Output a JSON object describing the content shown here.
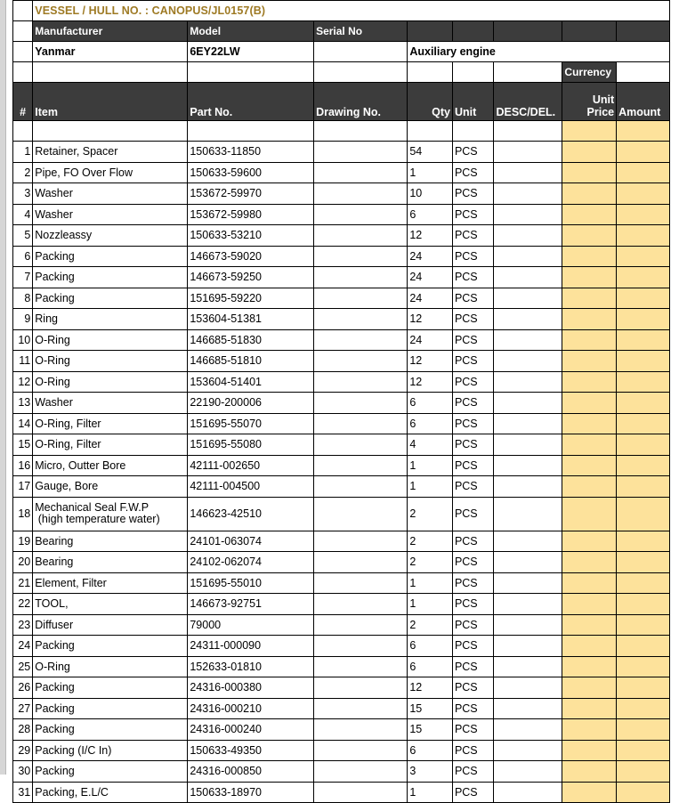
{
  "document": {
    "vessel_label": "VESSEL / HULL NO. : CANOPUS/JL0157(B)"
  },
  "vessel_info": {
    "headers": [
      "Manufacturer",
      "Model",
      "Serial No"
    ],
    "manufacturer": "Yanmar",
    "model": "6EY22LW",
    "serial_no": "",
    "description": "Auxiliary engine"
  },
  "currency": {
    "label": "Currency",
    "value": ""
  },
  "table": {
    "columns": {
      "num": "#",
      "item": "Item",
      "part_no": "Part No.",
      "drawing_no": "Drawing No.",
      "qty": "Qty",
      "unit": "Unit",
      "desc_del": "DESC/DEL.",
      "unit_price_line1": "Unit",
      "unit_price_line2": "Price",
      "amount": "Amount"
    },
    "rows": [
      {
        "num": "1",
        "item": "Retainer, Spacer",
        "part_no": "150633-11850",
        "drawing_no": "",
        "qty": "54",
        "unit": "PCS",
        "desc_del": "",
        "unit_price": "",
        "amount": ""
      },
      {
        "num": "2",
        "item": "Pipe, FO Over Flow",
        "part_no": "150633-59600",
        "drawing_no": "",
        "qty": "1",
        "unit": "PCS",
        "desc_del": "",
        "unit_price": "",
        "amount": ""
      },
      {
        "num": "3",
        "item": "Washer",
        "part_no": "153672-59970",
        "drawing_no": "",
        "qty": "10",
        "unit": "PCS",
        "desc_del": "",
        "unit_price": "",
        "amount": ""
      },
      {
        "num": "4",
        "item": "Washer",
        "part_no": "153672-59980",
        "drawing_no": "",
        "qty": "6",
        "unit": "PCS",
        "desc_del": "",
        "unit_price": "",
        "amount": ""
      },
      {
        "num": "5",
        "item": "Nozzleassy",
        "part_no": "150633-53210",
        "drawing_no": "",
        "qty": "12",
        "unit": "PCS",
        "desc_del": "",
        "unit_price": "",
        "amount": ""
      },
      {
        "num": "6",
        "item": "Packing",
        "part_no": "146673-59020",
        "drawing_no": "",
        "qty": "24",
        "unit": "PCS",
        "desc_del": "",
        "unit_price": "",
        "amount": ""
      },
      {
        "num": "7",
        "item": "Packing",
        "part_no": "146673-59250",
        "drawing_no": "",
        "qty": "24",
        "unit": "PCS",
        "desc_del": "",
        "unit_price": "",
        "amount": ""
      },
      {
        "num": "8",
        "item": "Packing",
        "part_no": "151695-59220",
        "drawing_no": "",
        "qty": "24",
        "unit": "PCS",
        "desc_del": "",
        "unit_price": "",
        "amount": ""
      },
      {
        "num": "9",
        "item": "Ring",
        "part_no": "153604-51381",
        "drawing_no": "",
        "qty": "12",
        "unit": "PCS",
        "desc_del": "",
        "unit_price": "",
        "amount": ""
      },
      {
        "num": "10",
        "item": "O-Ring",
        "part_no": "146685-51830",
        "drawing_no": "",
        "qty": "24",
        "unit": "PCS",
        "desc_del": "",
        "unit_price": "",
        "amount": ""
      },
      {
        "num": "11",
        "item": "O-Ring",
        "part_no": "146685-51810",
        "drawing_no": "",
        "qty": "12",
        "unit": "PCS",
        "desc_del": "",
        "unit_price": "",
        "amount": ""
      },
      {
        "num": "12",
        "item": "O-Ring",
        "part_no": "153604-51401",
        "drawing_no": "",
        "qty": "12",
        "unit": "PCS",
        "desc_del": "",
        "unit_price": "",
        "amount": ""
      },
      {
        "num": "13",
        "item": "Washer",
        "part_no": "22190-200006",
        "drawing_no": "",
        "qty": "6",
        "unit": "PCS",
        "desc_del": "",
        "unit_price": "",
        "amount": ""
      },
      {
        "num": "14",
        "item": "O-Ring, Filter",
        "part_no": "151695-55070",
        "drawing_no": "",
        "qty": "6",
        "unit": "PCS",
        "desc_del": "",
        "unit_price": "",
        "amount": ""
      },
      {
        "num": "15",
        "item": "O-Ring, Filter",
        "part_no": "151695-55080",
        "drawing_no": "",
        "qty": "4",
        "unit": "PCS",
        "desc_del": "",
        "unit_price": "",
        "amount": ""
      },
      {
        "num": "16",
        "item": "Micro, Outter Bore",
        "part_no": "42111-002650",
        "drawing_no": "",
        "qty": "1",
        "unit": "PCS",
        "desc_del": "",
        "unit_price": "",
        "amount": ""
      },
      {
        "num": "17",
        "item": "Gauge, Bore",
        "part_no": "42111-004500",
        "drawing_no": "",
        "qty": "1",
        "unit": "PCS",
        "desc_del": "",
        "unit_price": "",
        "amount": ""
      },
      {
        "num": "18",
        "item": "Mechanical Seal F.W.P\n (high temperature water)",
        "part_no": "146623-42510",
        "drawing_no": "",
        "qty": "2",
        "unit": "PCS",
        "desc_del": "",
        "unit_price": "",
        "amount": "",
        "tall": true
      },
      {
        "num": "19",
        "item": "Bearing",
        "part_no": "24101-063074",
        "drawing_no": "",
        "qty": "2",
        "unit": "PCS",
        "desc_del": "",
        "unit_price": "",
        "amount": ""
      },
      {
        "num": "20",
        "item": "Bearing",
        "part_no": "24102-062074",
        "drawing_no": "",
        "qty": "2",
        "unit": "PCS",
        "desc_del": "",
        "unit_price": "",
        "amount": ""
      },
      {
        "num": "21",
        "item": "Element, Filter",
        "part_no": "151695-55010",
        "drawing_no": "",
        "qty": "1",
        "unit": "PCS",
        "desc_del": "",
        "unit_price": "",
        "amount": ""
      },
      {
        "num": "22",
        "item": "TOOL,",
        "part_no": "146673-92751",
        "drawing_no": "",
        "qty": "1",
        "unit": "PCS",
        "desc_del": "",
        "unit_price": "",
        "amount": ""
      },
      {
        "num": "23",
        "item": "Diffuser",
        "part_no": "79000",
        "drawing_no": "",
        "qty": "2",
        "unit": "PCS",
        "desc_del": "",
        "unit_price": "",
        "amount": ""
      },
      {
        "num": "24",
        "item": "Packing",
        "part_no": "24311-000090",
        "drawing_no": "",
        "qty": "6",
        "unit": "PCS",
        "desc_del": "",
        "unit_price": "",
        "amount": ""
      },
      {
        "num": "25",
        "item": "O-Ring",
        "part_no": "152633-01810",
        "drawing_no": "",
        "qty": "6",
        "unit": "PCS",
        "desc_del": "",
        "unit_price": "",
        "amount": ""
      },
      {
        "num": "26",
        "item": "Packing",
        "part_no": "24316-000380",
        "drawing_no": "",
        "qty": "12",
        "unit": "PCS",
        "desc_del": "",
        "unit_price": "",
        "amount": ""
      },
      {
        "num": "27",
        "item": "Packing",
        "part_no": "24316-000210",
        "drawing_no": "",
        "qty": "15",
        "unit": "PCS",
        "desc_del": "",
        "unit_price": "",
        "amount": ""
      },
      {
        "num": "28",
        "item": "Packing",
        "part_no": "24316-000240",
        "drawing_no": "",
        "qty": "15",
        "unit": "PCS",
        "desc_del": "",
        "unit_price": "",
        "amount": ""
      },
      {
        "num": "29",
        "item": "Packing (I/C In)",
        "part_no": "150633-49350",
        "drawing_no": "",
        "qty": "6",
        "unit": "PCS",
        "desc_del": "",
        "unit_price": "",
        "amount": ""
      },
      {
        "num": "30",
        "item": "Packing",
        "part_no": "24316-000850",
        "drawing_no": "",
        "qty": "3",
        "unit": "PCS",
        "desc_del": "",
        "unit_price": "",
        "amount": ""
      },
      {
        "num": "31",
        "item": "Packing, E.L/C",
        "part_no": "150633-18970",
        "drawing_no": "",
        "qty": "1",
        "unit": "PCS",
        "desc_del": "",
        "unit_price": "",
        "amount": ""
      }
    ]
  },
  "colors": {
    "header_bg": "#3c3c3c",
    "header_text": "#ffffff",
    "title_text": "#9e7a24",
    "money_fill": "#fde29b",
    "gutter": "#d6d6d6"
  }
}
